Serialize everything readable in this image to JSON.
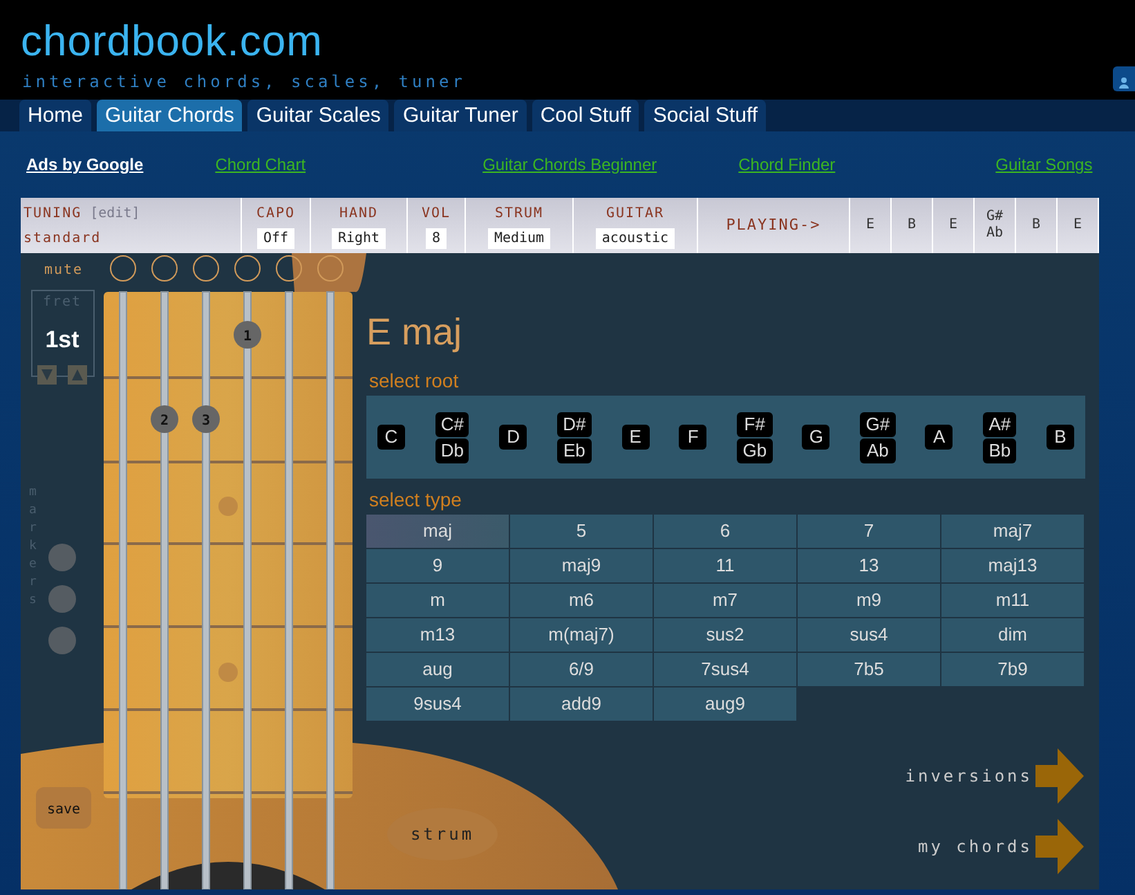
{
  "header": {
    "logo": "chordbook.com",
    "tagline": "interactive chords, scales, tuner"
  },
  "nav_tabs": [
    {
      "label": "Home",
      "selected": false
    },
    {
      "label": "Guitar Chords",
      "selected": true
    },
    {
      "label": "Guitar Scales",
      "selected": false
    },
    {
      "label": "Guitar Tuner",
      "selected": false
    },
    {
      "label": "Cool Stuff",
      "selected": false
    },
    {
      "label": "Social Stuff",
      "selected": false
    }
  ],
  "ad_links": {
    "title": "Ads by Google",
    "links": [
      "Chord Chart",
      "Guitar Chords Beginner",
      "Chord Finder",
      "Guitar Songs"
    ]
  },
  "settings": {
    "tuning_label": "TUNING",
    "edit_link": "[edit]",
    "tuning_value": "standard",
    "fields": [
      {
        "label": "CAPO",
        "value": "Off"
      },
      {
        "label": "HAND",
        "value": "Right"
      },
      {
        "label": "VOL",
        "value": "8"
      },
      {
        "label": "STRUM",
        "value": "Medium"
      },
      {
        "label": "GUITAR",
        "value": "acoustic"
      }
    ],
    "playing_label": "PLAYING->",
    "playing_notes": [
      [
        "E"
      ],
      [
        "B"
      ],
      [
        "E"
      ],
      [
        "G#",
        "Ab"
      ],
      [
        "B"
      ],
      [
        "E"
      ]
    ]
  },
  "guitar": {
    "mute_label": "mute",
    "fret_label": "fret",
    "fret_value": "1st",
    "markers_label": "markers",
    "save_button": "save",
    "strum_button": "strum",
    "fret_rows": [
      [
        {
          "kind": "none"
        },
        {
          "kind": "none"
        },
        {
          "kind": "none"
        },
        {
          "kind": "finger",
          "label": "1"
        },
        {
          "kind": "none"
        },
        {
          "kind": "none"
        }
      ],
      [
        {
          "kind": "none"
        },
        {
          "kind": "finger",
          "label": "2"
        },
        {
          "kind": "finger",
          "label": "3"
        },
        {
          "kind": "none"
        },
        {
          "kind": "none"
        },
        {
          "kind": "none"
        }
      ]
    ]
  },
  "chord": {
    "title": "E maj",
    "root_label": "select root",
    "roots": [
      [
        "C"
      ],
      [
        "C#",
        "Db"
      ],
      [
        "D"
      ],
      [
        "D#",
        "Eb"
      ],
      [
        "E"
      ],
      [
        "F"
      ],
      [
        "F#",
        "Gb"
      ],
      [
        "G"
      ],
      [
        "G#",
        "Ab"
      ],
      [
        "A"
      ],
      [
        "A#",
        "Bb"
      ],
      [
        "B"
      ]
    ],
    "type_label": "select type",
    "types": [
      {
        "label": "maj",
        "selected": true
      },
      {
        "label": "5",
        "selected": false
      },
      {
        "label": "6",
        "selected": false
      },
      {
        "label": "7",
        "selected": false
      },
      {
        "label": "maj7",
        "selected": false
      },
      {
        "label": "9",
        "selected": false
      },
      {
        "label": "maj9",
        "selected": false
      },
      {
        "label": "11",
        "selected": false
      },
      {
        "label": "13",
        "selected": false
      },
      {
        "label": "maj13",
        "selected": false
      },
      {
        "label": "m",
        "selected": false
      },
      {
        "label": "m6",
        "selected": false
      },
      {
        "label": "m7",
        "selected": false
      },
      {
        "label": "m9",
        "selected": false
      },
      {
        "label": "m11",
        "selected": false
      },
      {
        "label": "m13",
        "selected": false
      },
      {
        "label": "m(maj7)",
        "selected": false
      },
      {
        "label": "sus2",
        "selected": false
      },
      {
        "label": "sus4",
        "selected": false
      },
      {
        "label": "dim",
        "selected": false
      },
      {
        "label": "aug",
        "selected": false
      },
      {
        "label": "6/9",
        "selected": false
      },
      {
        "label": "7sus4",
        "selected": false
      },
      {
        "label": "7b5",
        "selected": false
      },
      {
        "label": "7b9",
        "selected": false
      },
      {
        "label": "9sus4",
        "selected": false
      },
      {
        "label": "add9",
        "selected": false
      },
      {
        "label": "aug9",
        "selected": false
      }
    ],
    "actions": [
      "inversions",
      "my chords"
    ]
  }
}
